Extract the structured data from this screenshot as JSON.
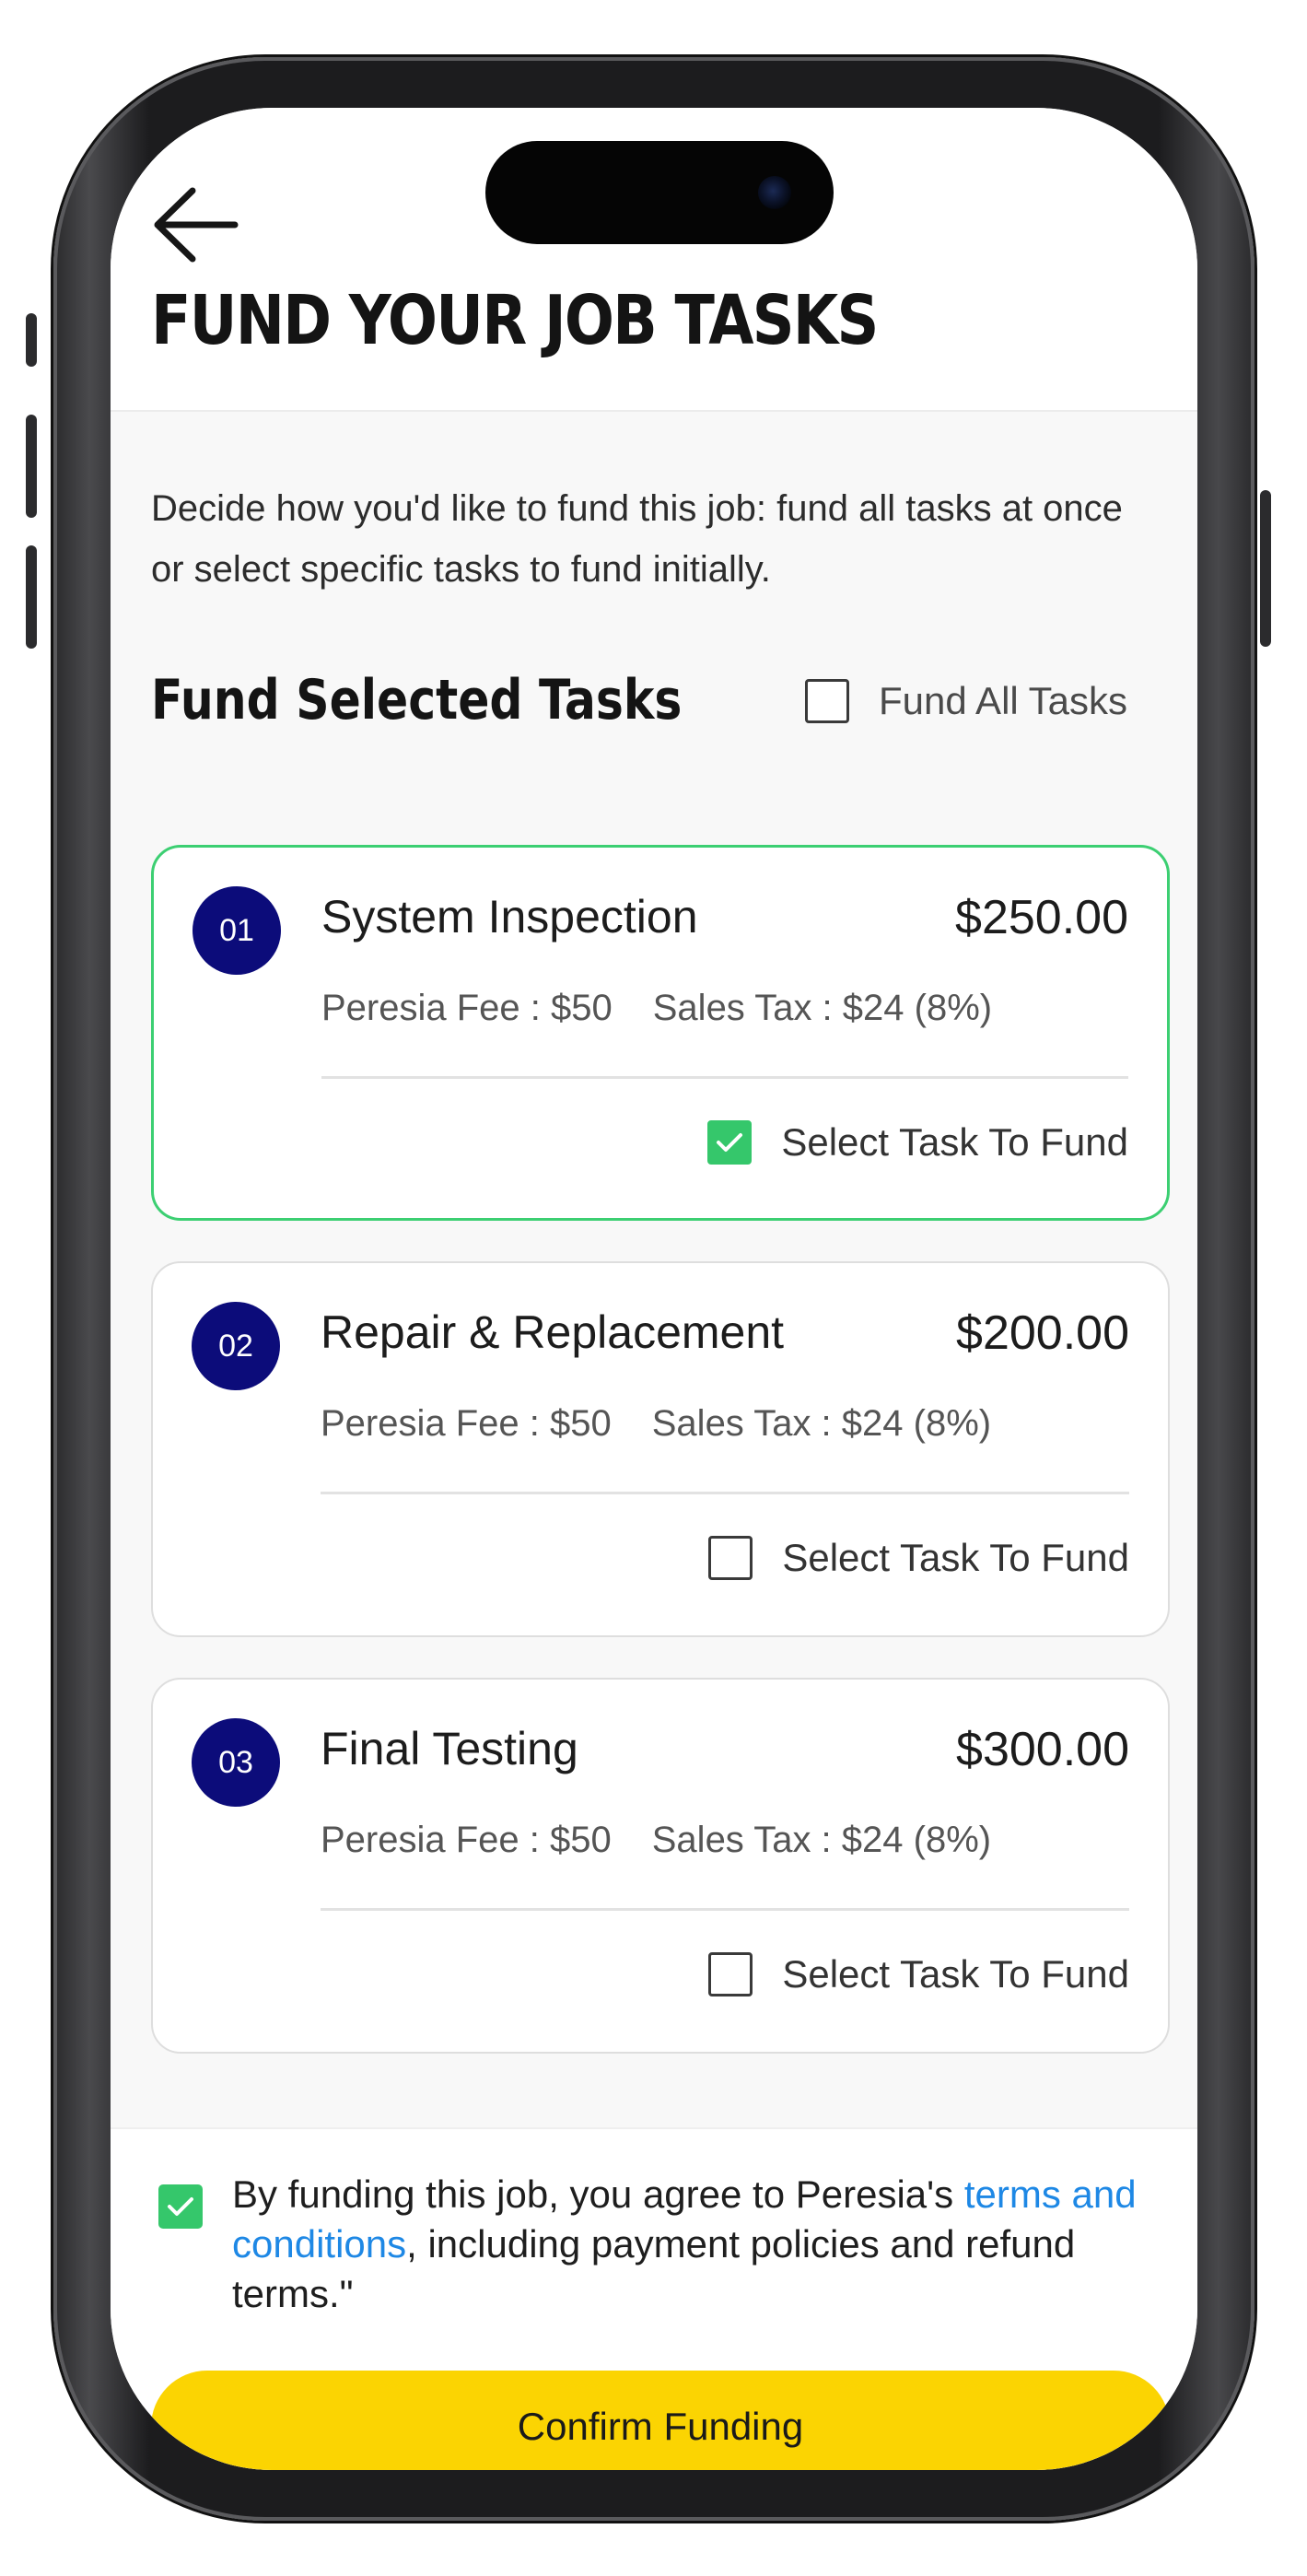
{
  "header": {
    "title": "FUND YOUR JOB TASKS",
    "back_icon": "arrow-left-icon"
  },
  "intro": "Decide how you'd like to fund this job: fund all tasks at once or select specific tasks to fund initially.",
  "section": {
    "title": "Fund Selected Tasks",
    "fund_all_label": "Fund All Tasks",
    "fund_all_checked": false
  },
  "tasks": [
    {
      "number": "01",
      "name": "System Inspection",
      "price": "$250.00",
      "fee": "Peresia Fee : $50",
      "tax": "Sales Tax : $24 (8%)",
      "select_label": "Select Task To Fund",
      "checked": true
    },
    {
      "number": "02",
      "name": "Repair & Replacement",
      "price": "$200.00",
      "fee": "Peresia Fee : $50",
      "tax": "Sales Tax : $24 (8%)",
      "select_label": "Select Task To Fund",
      "checked": false
    },
    {
      "number": "03",
      "name": "Final Testing",
      "price": "$300.00",
      "fee": "Peresia Fee : $50",
      "tax": "Sales Tax : $24 (8%)",
      "select_label": "Select Task To Fund",
      "checked": false
    }
  ],
  "footer": {
    "agree_checked": true,
    "agree_prefix": "By funding this job, you agree to Peresia's ",
    "agree_link": "terms and conditions",
    "agree_suffix": ", including payment policies and refund terms.\"",
    "confirm_label": "Confirm Funding"
  },
  "colors": {
    "accent_yellow": "#fbd402",
    "check_green": "#35c76b",
    "selected_border": "#3ccf72",
    "badge_navy": "#0c0c7a",
    "link_blue": "#1e88e5"
  }
}
